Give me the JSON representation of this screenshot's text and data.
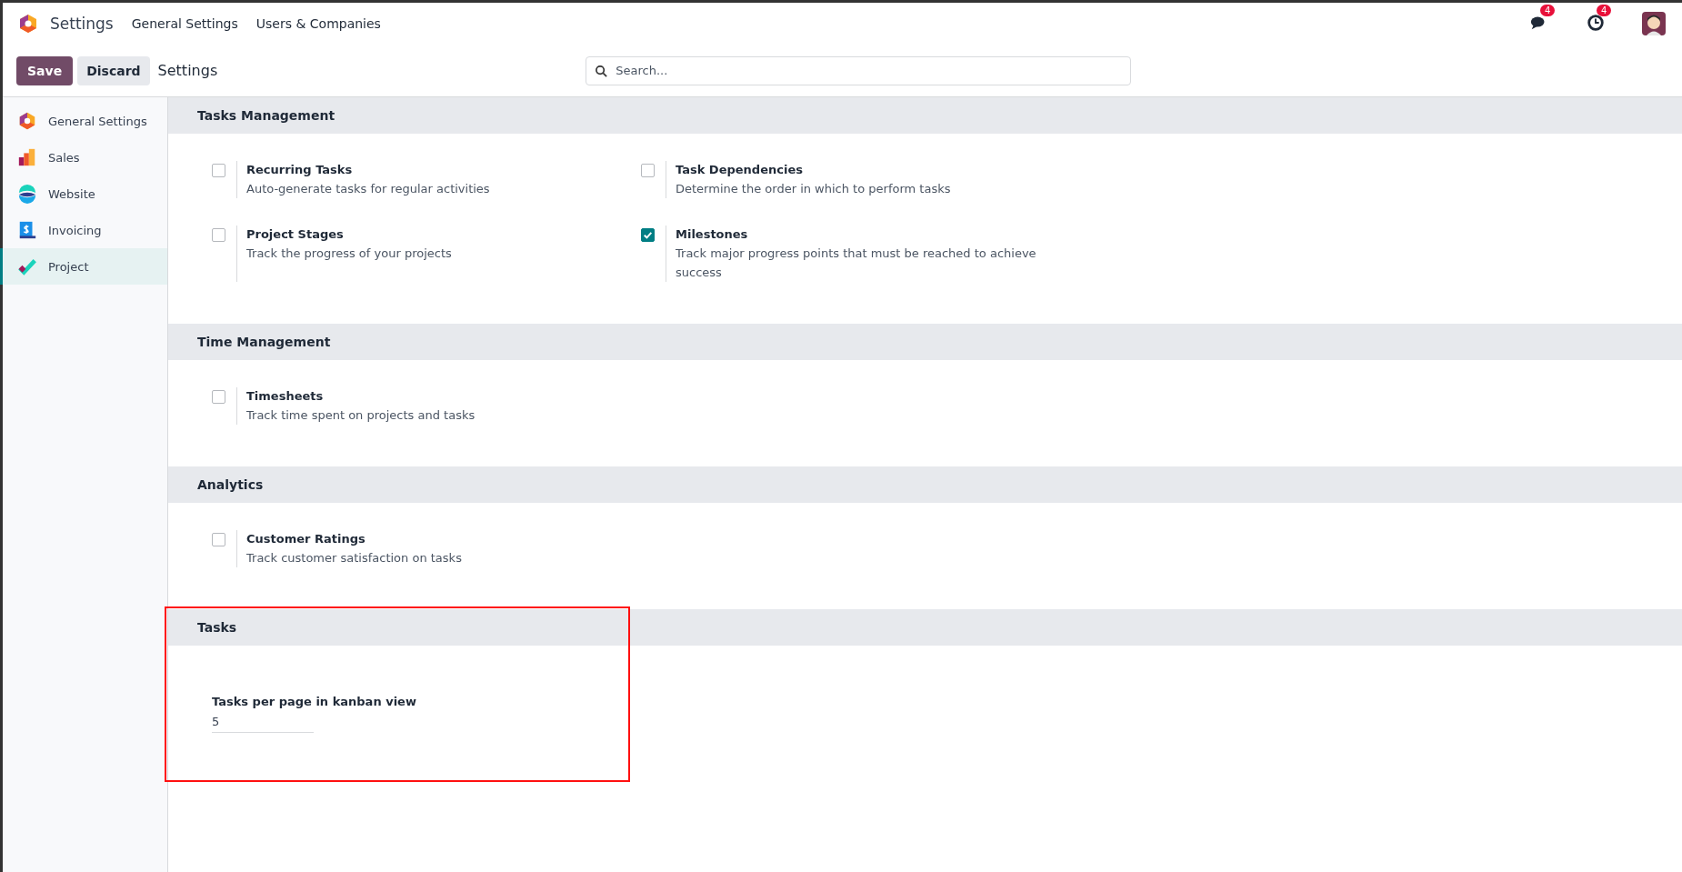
{
  "navbar": {
    "app_title": "Settings",
    "menu": [
      "General Settings",
      "Users & Companies"
    ],
    "messages_badge": "4",
    "activities_badge": "4"
  },
  "control_panel": {
    "save": "Save",
    "discard": "Discard",
    "breadcrumb": "Settings",
    "search": {
      "placeholder": "Search..."
    }
  },
  "sidebar": {
    "items": [
      {
        "label": "General Settings",
        "kind": "general",
        "selected": false
      },
      {
        "label": "Sales",
        "kind": "sales",
        "selected": false
      },
      {
        "label": "Website",
        "kind": "website",
        "selected": false
      },
      {
        "label": "Invoicing",
        "kind": "invoicing",
        "selected": false
      },
      {
        "label": "Project",
        "kind": "project",
        "selected": true
      }
    ]
  },
  "sections": [
    {
      "title": "Tasks Management",
      "highlighted": false,
      "settings": [
        {
          "kind": "checkbox",
          "label": "Recurring Tasks",
          "description": "Auto-generate tasks for regular activities",
          "checked": false
        },
        {
          "kind": "checkbox",
          "label": "Task Dependencies",
          "description": "Determine the order in which to perform tasks",
          "checked": false
        },
        {
          "kind": "checkbox",
          "label": "Project Stages",
          "description": "Track the progress of your projects",
          "checked": false
        },
        {
          "kind": "checkbox",
          "label": "Milestones",
          "description": "Track major progress points that must be reached to achieve success",
          "checked": true
        }
      ]
    },
    {
      "title": "Time Management",
      "highlighted": false,
      "settings": [
        {
          "kind": "checkbox",
          "label": "Timesheets",
          "description": "Track time spent on projects and tasks",
          "checked": false
        }
      ]
    },
    {
      "title": "Analytics",
      "highlighted": false,
      "settings": [
        {
          "kind": "checkbox",
          "label": "Customer Ratings",
          "description": "Track customer satisfaction on tasks",
          "checked": false
        }
      ]
    },
    {
      "title": "Tasks",
      "highlighted": true,
      "settings": [
        {
          "kind": "field",
          "label": "Tasks per page in kanban view",
          "value": "5"
        }
      ]
    }
  ]
}
